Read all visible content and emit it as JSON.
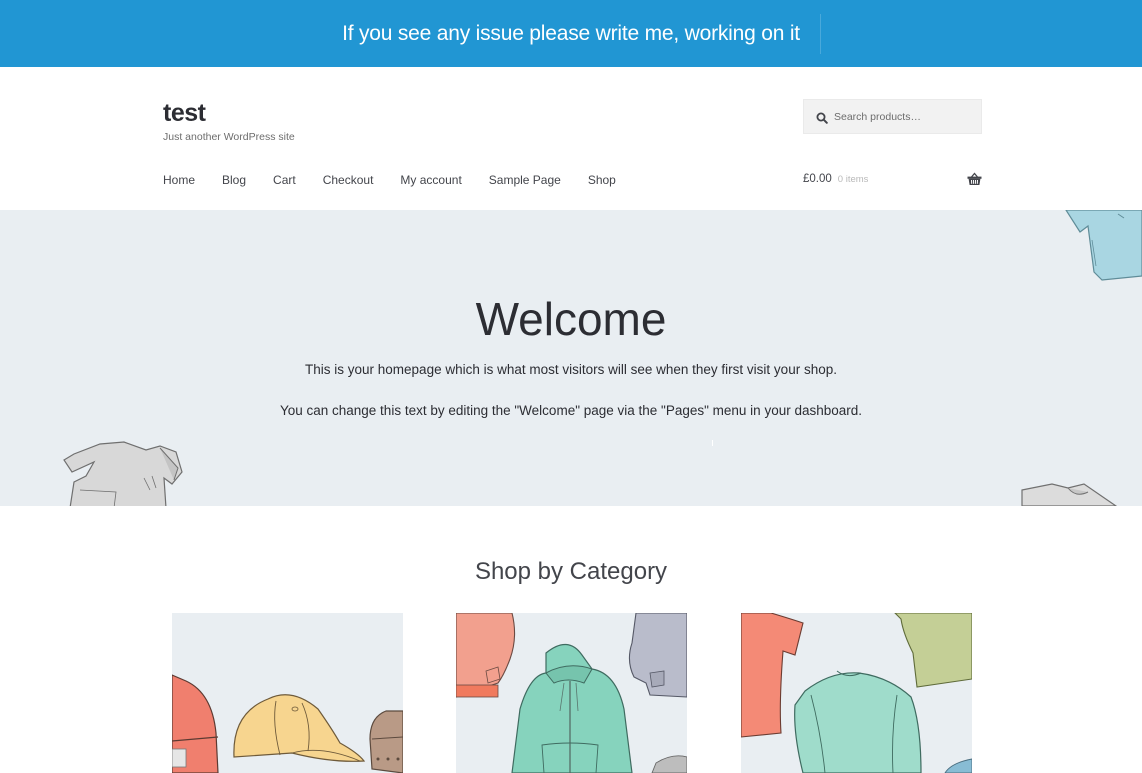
{
  "notice": {
    "text": "If you see any issue please write me, working on it",
    "background": "#2196d3"
  },
  "header": {
    "site_title": "test",
    "tagline": "Just another WordPress site",
    "search": {
      "placeholder": "Search products…",
      "value": "",
      "icon": "search-icon"
    },
    "nav": [
      {
        "label": "Home"
      },
      {
        "label": "Blog"
      },
      {
        "label": "Cart"
      },
      {
        "label": "Checkout"
      },
      {
        "label": "My account"
      },
      {
        "label": "Sample Page"
      },
      {
        "label": "Shop"
      }
    ],
    "cart": {
      "amount": "£0.00",
      "count": "0 items",
      "icon": "basket-icon"
    }
  },
  "hero": {
    "title": "Welcome",
    "line1": "This is your homepage which is what most visitors will see when they first visit your shop.",
    "line2": "You can change this text by editing the \"Welcome\" page via the \"Pages\" menu in your dashboard.",
    "background": "#e9eef2"
  },
  "categories": {
    "title": "Shop by Category",
    "items": [
      {
        "image": "accessories-illustration"
      },
      {
        "image": "hoodies-illustration"
      },
      {
        "image": "tshirts-illustration"
      }
    ]
  }
}
